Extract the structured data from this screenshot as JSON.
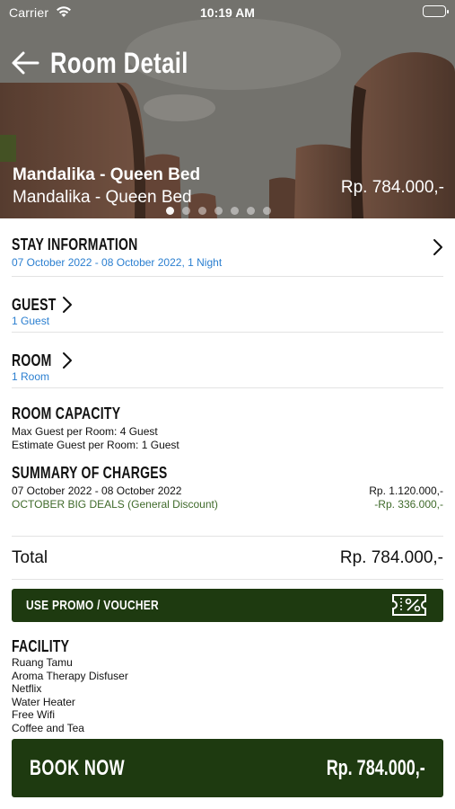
{
  "status_bar": {
    "carrier": "Carrier",
    "time": "10:19 AM"
  },
  "header": {
    "title": "Room Detail"
  },
  "hero": {
    "room_name": "Mandalika - Queen Bed",
    "room_subtitle": "Mandalika - Queen Bed",
    "price": "Rp. 784.000,-",
    "carousel": {
      "count": 7,
      "active_index": 0
    }
  },
  "stay_information": {
    "title": "STAY INFORMATION",
    "value": "07 October 2022 - 08 October 2022, 1 Night"
  },
  "guest": {
    "title": "GUEST",
    "value": "1 Guest"
  },
  "room": {
    "title": "ROOM",
    "value": "1 Room"
  },
  "room_capacity": {
    "title": "ROOM CAPACITY",
    "max_guest": "Max Guest per Room: 4 Guest",
    "estimate_guest": "Estimate Guest per Room: 1 Guest"
  },
  "summary": {
    "title": "SUMMARY OF CHARGES",
    "lines": [
      {
        "label": "07 October 2022 - 08 October 2022",
        "amount": "Rp. 1.120.000,-"
      },
      {
        "label": "OCTOBER BIG DEALS (General Discount)",
        "amount": "-Rp. 336.000,-"
      }
    ]
  },
  "total": {
    "label": "Total",
    "amount": "Rp. 784.000,-"
  },
  "promo": {
    "label": "USE PROMO / VOUCHER",
    "icon": "voucher-percent-icon"
  },
  "facility": {
    "title": "FACILITY",
    "items": [
      "Ruang Tamu",
      "Aroma Therapy Disfuser",
      "Netflix",
      "Water Heater",
      "Free Wifi",
      "Coffee and Tea"
    ]
  },
  "book": {
    "label": "BOOK NOW",
    "price": "Rp. 784.000,-"
  },
  "colors": {
    "primary": "#1e3a10",
    "link": "#2b7fd0",
    "discount": "#3f6a2a"
  }
}
